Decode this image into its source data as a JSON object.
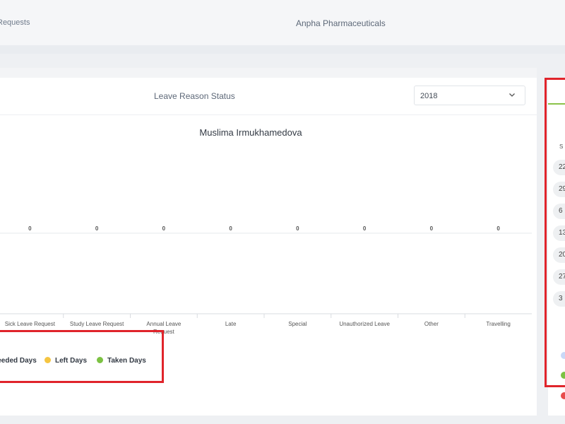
{
  "header": {
    "breadcrumb": "Requests",
    "company": "Anpha Pharmaceuticals"
  },
  "panel": {
    "title": "Leave Reason Status",
    "year_select": {
      "value": "2018"
    }
  },
  "chart_data": {
    "type": "bar",
    "title": "Muslima Irmukhamedova",
    "categories": [
      "Sick Leave Request",
      "Study Leave Request",
      "Annual Leave Request",
      "Late",
      "Special",
      "Unauthorized Leave",
      "Other",
      "Travelling"
    ],
    "values": [
      0,
      0,
      0,
      0,
      0,
      0,
      0,
      0
    ],
    "value_labels": [
      "0",
      "0",
      "0",
      "0",
      "0",
      "0",
      "0",
      "0"
    ],
    "legend": [
      {
        "label": "Needed Days",
        "color": "#a9c6f5"
      },
      {
        "label": "Left Days",
        "color": "#f5c542"
      },
      {
        "label": "Taken Days",
        "color": "#7cc243"
      }
    ],
    "grid": true
  },
  "calendar": {
    "weekday_header": "S",
    "days": [
      "22",
      "29",
      "6",
      "13",
      "20",
      "27",
      "3"
    ]
  },
  "side_legend_colors": [
    "#c9d8f7",
    "#7cc243",
    "#e84c4c"
  ]
}
